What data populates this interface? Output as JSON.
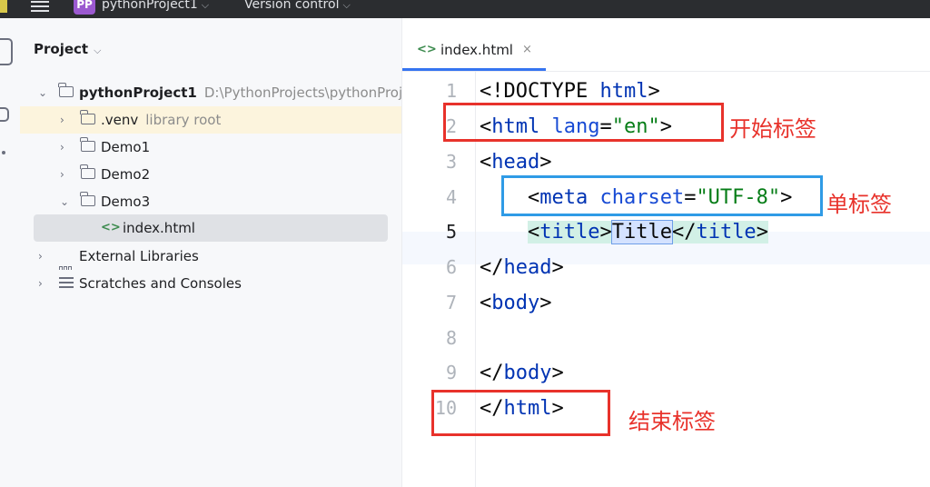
{
  "titlebar": {
    "project_badge": "PP",
    "project_name": "pythonProject1",
    "vcs_label": "Version control"
  },
  "project_panel": {
    "title": "Project",
    "tree": [
      {
        "label": "pythonProject1",
        "hint": "D:\\PythonProjects\\pythonProjec",
        "type": "folder",
        "expanded": true
      },
      {
        "label": ".venv",
        "hint": "library root",
        "type": "folder",
        "expanded": false
      },
      {
        "label": "Demo1",
        "type": "folder",
        "expanded": false
      },
      {
        "label": "Demo2",
        "type": "folder",
        "expanded": false
      },
      {
        "label": "Demo3",
        "type": "folder",
        "expanded": true
      },
      {
        "label": "index.html",
        "type": "html-file",
        "selected": true
      },
      {
        "label": "External Libraries",
        "type": "library",
        "expanded": false
      },
      {
        "label": "Scratches and Consoles",
        "type": "scratches",
        "expanded": false
      }
    ]
  },
  "editor": {
    "tab": {
      "label": "index.html",
      "close": "×"
    },
    "current_line": 5,
    "line_numbers": [
      "1",
      "2",
      "3",
      "4",
      "5",
      "6",
      "7",
      "8",
      "9",
      "10"
    ],
    "code": {
      "l1": {
        "open": "<!DOCTYPE ",
        "kw": "html",
        "close": ">"
      },
      "l2": {
        "lt": "<",
        "tag": "html",
        "attr": " lang",
        "eq": "=",
        "val": "\"en\"",
        "gt": ">"
      },
      "l3": {
        "lt": "<",
        "tag": "head",
        "gt": ">"
      },
      "l4": {
        "indent": "    ",
        "lt": "<",
        "tag": "meta",
        "attr": " charset",
        "eq": "=",
        "val": "\"UTF-8\"",
        "gt": ">"
      },
      "l5": {
        "indent": "    ",
        "lt": "<",
        "tag": "title",
        "gt": ">",
        "text": "Title",
        "lt2": "</",
        "tag2": "title",
        "gt2": ">"
      },
      "l6": {
        "lt": "</",
        "tag": "head",
        "gt": ">"
      },
      "l7": {
        "lt": "<",
        "tag": "body",
        "gt": ">"
      },
      "l9": {
        "lt": "</",
        "tag": "body",
        "gt": ">"
      },
      "l10": {
        "lt": "</",
        "tag": "html",
        "gt": ">"
      }
    }
  },
  "annotations": {
    "start_tag": "开始标签",
    "single_tag": "单标签",
    "end_tag": "结束标签",
    "colors": {
      "red": "#e8322b",
      "blue": "#2f9be6"
    }
  }
}
